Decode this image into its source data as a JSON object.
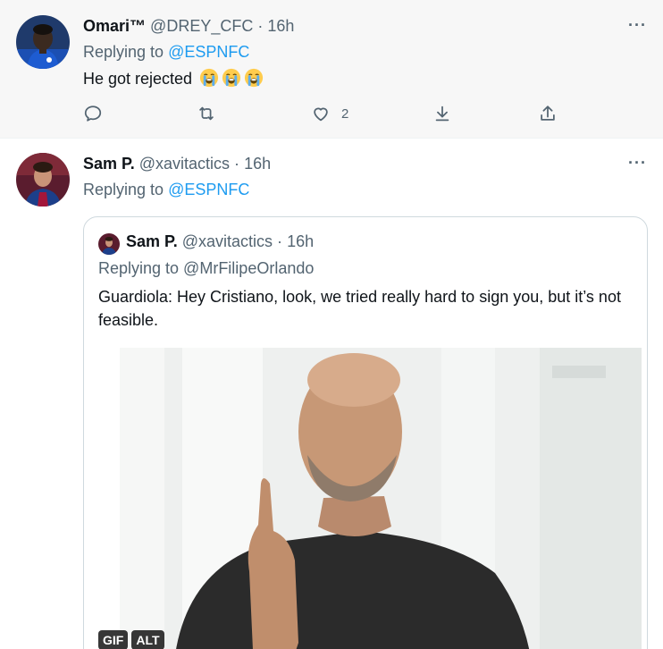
{
  "tweets": [
    {
      "display_name": "Omari™",
      "handle": "@DREY_CFC",
      "time": "16h",
      "replying_prefix": "Replying to",
      "replying_to": "@ESPNFC",
      "text": "He got rejected",
      "emoji": "loudly-crying-face",
      "emoji_count": 3,
      "likes": "2"
    },
    {
      "display_name": "Sam P.",
      "handle": "@xavitactics",
      "time": "16h",
      "replying_prefix": "Replying to",
      "replying_to": "@ESPNFC",
      "quoted": {
        "display_name": "Sam P.",
        "handle": "@xavitactics",
        "time": "16h",
        "replying": "Replying to @MrFilipeOrlando",
        "text": "Guardiola: Hey Cristiano, look, we tried really hard to sign you, but it’s not feasible.",
        "media_badges": [
          "GIF",
          "ALT"
        ]
      }
    }
  ],
  "separator": "·",
  "more_glyph": "···",
  "colors": {
    "accent": "#1d9bf0",
    "secondary_text": "#536471",
    "primary_text": "#0f1419",
    "highlight_bg": "#f7f7f7"
  },
  "icons": [
    "more-icon",
    "reply-icon",
    "retweet-icon",
    "like-icon",
    "download-icon",
    "share-icon"
  ]
}
